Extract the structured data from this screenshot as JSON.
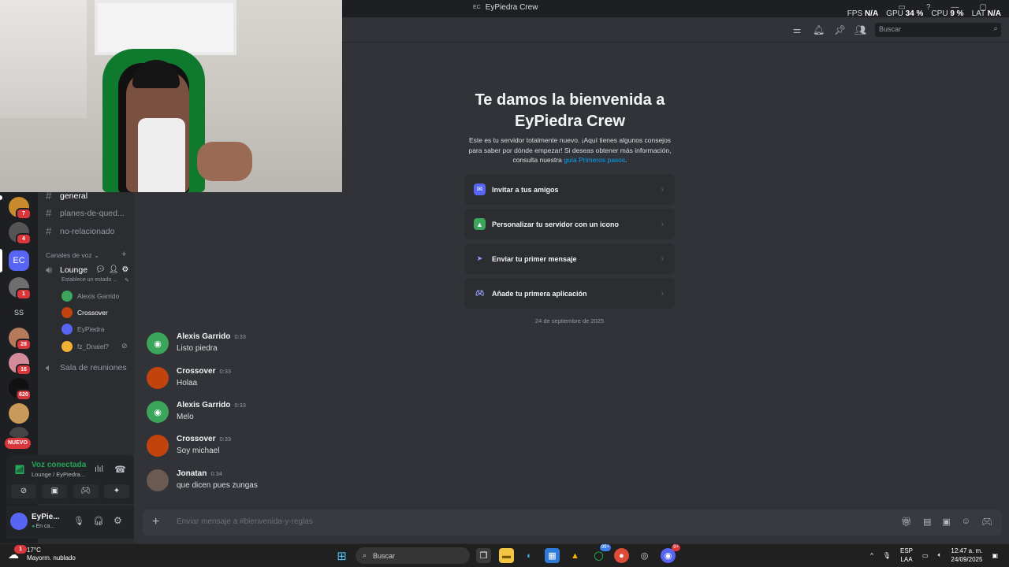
{
  "titlebar": {
    "server_abbrev": "EC",
    "server_name": "EyPiedra Crew",
    "perf": [
      {
        "label": "FPS",
        "value": "N/A"
      },
      {
        "label": "GPU",
        "value": "34 %"
      },
      {
        "label": "CPU",
        "value": "9 %"
      },
      {
        "label": "LAT",
        "value": "N/A"
      }
    ]
  },
  "toolbar": {
    "icons": [
      "threads-icon",
      "bell-icon",
      "pin-icon",
      "members-icon"
    ],
    "search_placeholder": "Buscar"
  },
  "rail": {
    "servers": [
      {
        "name": "server-1",
        "badge": "7",
        "color": "#c98a2d"
      },
      {
        "name": "server-2",
        "badge": "4",
        "color": "#555"
      },
      {
        "name": "server-ec",
        "label": "EC",
        "color": "#5865f2",
        "active": true
      },
      {
        "name": "server-lamb",
        "badge": "1",
        "color": "#6e6e6e"
      },
      {
        "name": "server-ss",
        "label": "SS",
        "color": "#1e1f22"
      },
      {
        "name": "server-6",
        "badge": "28",
        "color": "#b57a5a"
      },
      {
        "name": "server-7",
        "badge": "16",
        "color": "#d48b9a"
      },
      {
        "name": "server-8",
        "badge": "620",
        "color": "#111111"
      },
      {
        "name": "server-9",
        "color": "#c99a5a"
      },
      {
        "name": "server-10",
        "color": "#444"
      }
    ],
    "new_label": "NUEVO"
  },
  "channels": {
    "text": [
      {
        "name": "general",
        "active": true
      },
      {
        "name": "planes-de-qued..."
      },
      {
        "name": "no-relacionado"
      }
    ],
    "voice_category": "Canales de voz",
    "voice_channel": {
      "name": "Lounge",
      "status": "Establece un estado ..."
    },
    "voice_users": [
      {
        "name": "Alexis Garrido",
        "color": "#3ba55c"
      },
      {
        "name": "Crossover",
        "color": "#c1440e",
        "highlight": true
      },
      {
        "name": "EyPiedra",
        "color": "#5865f2"
      },
      {
        "name": "fz_Dnaiel?",
        "color": "#f0b232"
      }
    ],
    "other_voice": "Sala de reuniones"
  },
  "voice_panel": {
    "status": "Voz conectada",
    "location": "Lounge / EyPiedra..."
  },
  "user_panel": {
    "name": "EyPie...",
    "status": "En ca..."
  },
  "welcome": {
    "title": "Te damos la bienvenida a EyPiedra Crew",
    "desc_pre": "Este es tu servidor totalmente nuevo. ¡Aquí tienes algunos consejos para saber por dónde empezar! Si deseas obtener más información, consulta nuestra",
    "desc_link": "guía Primeros pasos",
    "desc_post": ".",
    "cards": [
      {
        "label": "Invitar a tus amigos",
        "icon": "invite-icon",
        "color": "#5865f2"
      },
      {
        "label": "Personalizar tu servidor con un icono",
        "icon": "customize-icon",
        "color": "#3ba55c"
      },
      {
        "label": "Enviar tu primer mensaje",
        "icon": "send-icon",
        "color": "#9aa4ff"
      },
      {
        "label": "Añade tu primera aplicación",
        "icon": "app-icon",
        "color": "#5865f2"
      }
    ],
    "date": "24 de septiembre de 2025"
  },
  "messages": [
    {
      "author": "Alexis Garrido",
      "time": "0:33",
      "text": "Listo piedra",
      "avatar_color": "#3ba55c",
      "avatar": "discord"
    },
    {
      "author": "Crossover",
      "time": "0:33",
      "text": "Holaa",
      "avatar_color": "#c1440e",
      "avatar": "photo"
    },
    {
      "author": "Alexis Garrido",
      "time": "0:33",
      "text": "Melo",
      "avatar_color": "#3ba55c",
      "avatar": "discord"
    },
    {
      "author": "Crossover",
      "time": "0:33",
      "text": "Soy michael",
      "avatar_color": "#c1440e",
      "avatar": "photo"
    },
    {
      "author": "Jonatan",
      "time": "0:34",
      "text": "que dicen pues zungas",
      "avatar_color": "#6b5a52",
      "avatar": "photo"
    }
  ],
  "composer": {
    "placeholder": "Enviar mensaje a #bienvenida-y-reglas"
  },
  "taskbar": {
    "temp": "17°C",
    "weather": "Mayorm. nublado",
    "weather_badge": "1",
    "search": "Buscar",
    "whatsapp_badge": "99+",
    "discord_badge": "9+",
    "lang1": "ESP",
    "lang2": "LAA",
    "time": "12:47 a. m.",
    "date": "24/09/2025"
  }
}
